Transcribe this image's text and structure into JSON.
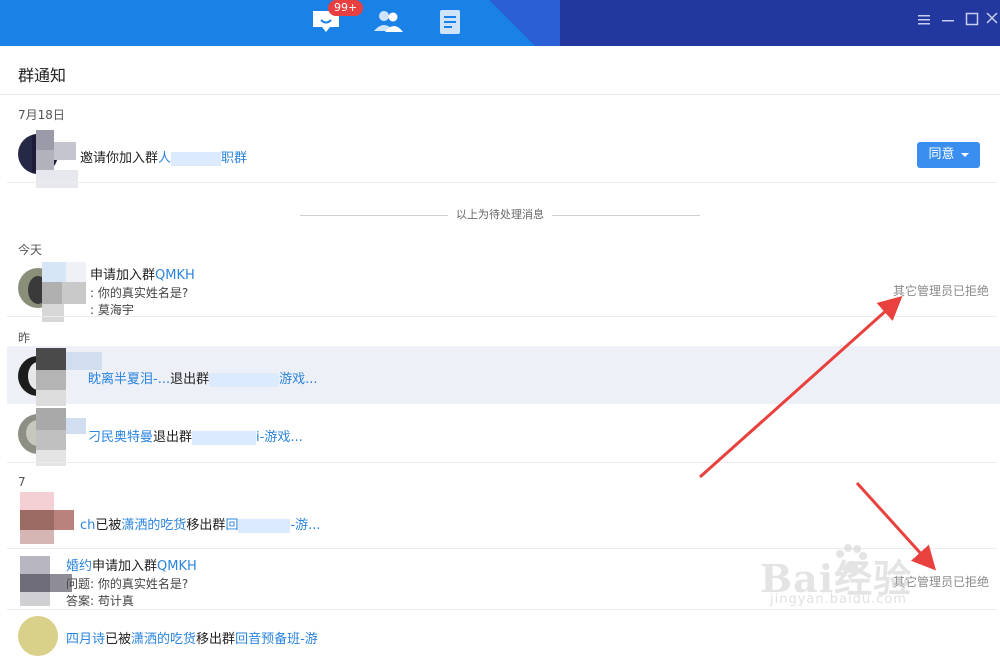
{
  "topbar": {
    "badge": "99+",
    "colors": {
      "bar": "#1a82e6",
      "dark": "#23389f",
      "badge": "#e84040"
    },
    "icons": [
      "notification-icon",
      "contacts-icon",
      "document-icon"
    ],
    "window_controls": [
      "menu-icon",
      "minimize-icon",
      "maximize-icon",
      "close-icon"
    ]
  },
  "header": {
    "title": "群通知"
  },
  "pending": {
    "date": "7月18日",
    "item": {
      "text_a": "邀请你加入群",
      "group_a": "人",
      "group_b": "职群",
      "button": "同意"
    }
  },
  "separator": "以上为待处理消息",
  "today": {
    "date": "今天",
    "item": {
      "action": "申请加入群",
      "group": "QMKH",
      "question": ": 你的真实姓名是?",
      "answer": ": 莫海宇",
      "status": "其它管理员已拒绝"
    }
  },
  "yesterday": {
    "date": "昨",
    "items": [
      {
        "user": "眈离半夏泪-...",
        "action": "退出群",
        "group": "游戏..."
      },
      {
        "user": "刁民奥特曼",
        "action": "退出群",
        "group": "i-游戏..."
      }
    ]
  },
  "older": {
    "date": "7",
    "items": [
      {
        "user": "ch",
        "action_a": "已被",
        "admin": "潇洒的吃货",
        "action_b": "移出群",
        "group_a": "回",
        "group_b": "-游..."
      },
      {
        "user": "婚约",
        "action": "申请加入群",
        "group": "QMKH",
        "question": "问题: 你的真实姓名是?",
        "answer": "答案: 苟计真",
        "status": "其它管理员已拒绝"
      },
      {
        "user": "四月诗",
        "action_a": "已被",
        "admin": "潇洒的吃货",
        "action_b": "移出群",
        "group": "回音预备班-游"
      }
    ]
  },
  "watermark": {
    "main": "Bai经验",
    "sub": "jingyan.baidu.com"
  }
}
